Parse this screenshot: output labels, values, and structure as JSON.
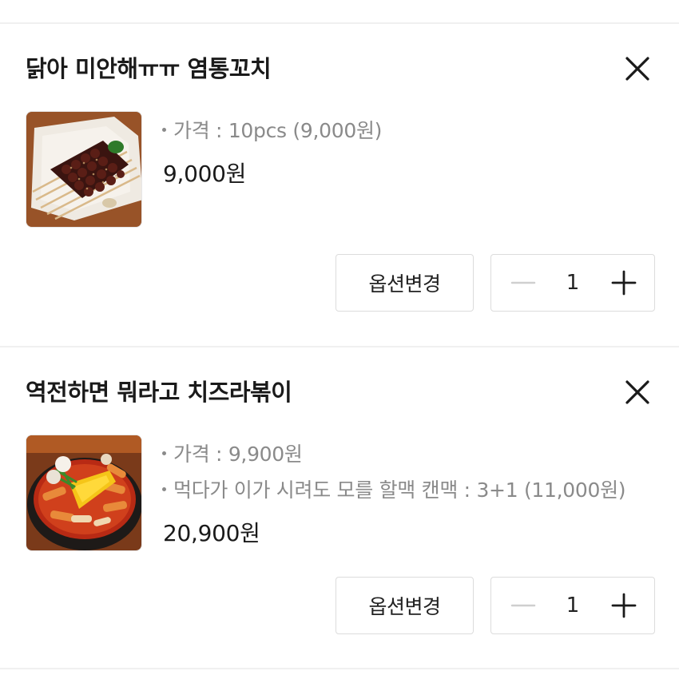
{
  "cart": {
    "items": [
      {
        "title": "닭아 미안해ㅠㅠ 염통꼬치",
        "image": "grilled-chicken-heart-skewers",
        "options": [
          "가격 : 10pcs (9,000원)"
        ],
        "price": "9,000원",
        "option_change_label": "옵션변경",
        "quantity": "1"
      },
      {
        "title": "역전하면 뭐라고 치즈라볶이",
        "image": "cheese-rabokki-hotpot",
        "options": [
          "가격 : 9,900원",
          "먹다가 이가 시려도 모를 할맥 캔맥 : 3+1 (11,000원)"
        ],
        "price": "20,900원",
        "option_change_label": "옵션변경",
        "quantity": "1"
      }
    ]
  },
  "icons": {
    "remove": "close-icon",
    "decrease": "minus-icon",
    "increase": "plus-icon"
  },
  "colors": {
    "text_primary": "#1a1a1a",
    "text_secondary": "#8a8a8a",
    "border": "#dcdcdc",
    "divider": "#f0f0f0",
    "minus_disabled": "#cfcfcf"
  }
}
